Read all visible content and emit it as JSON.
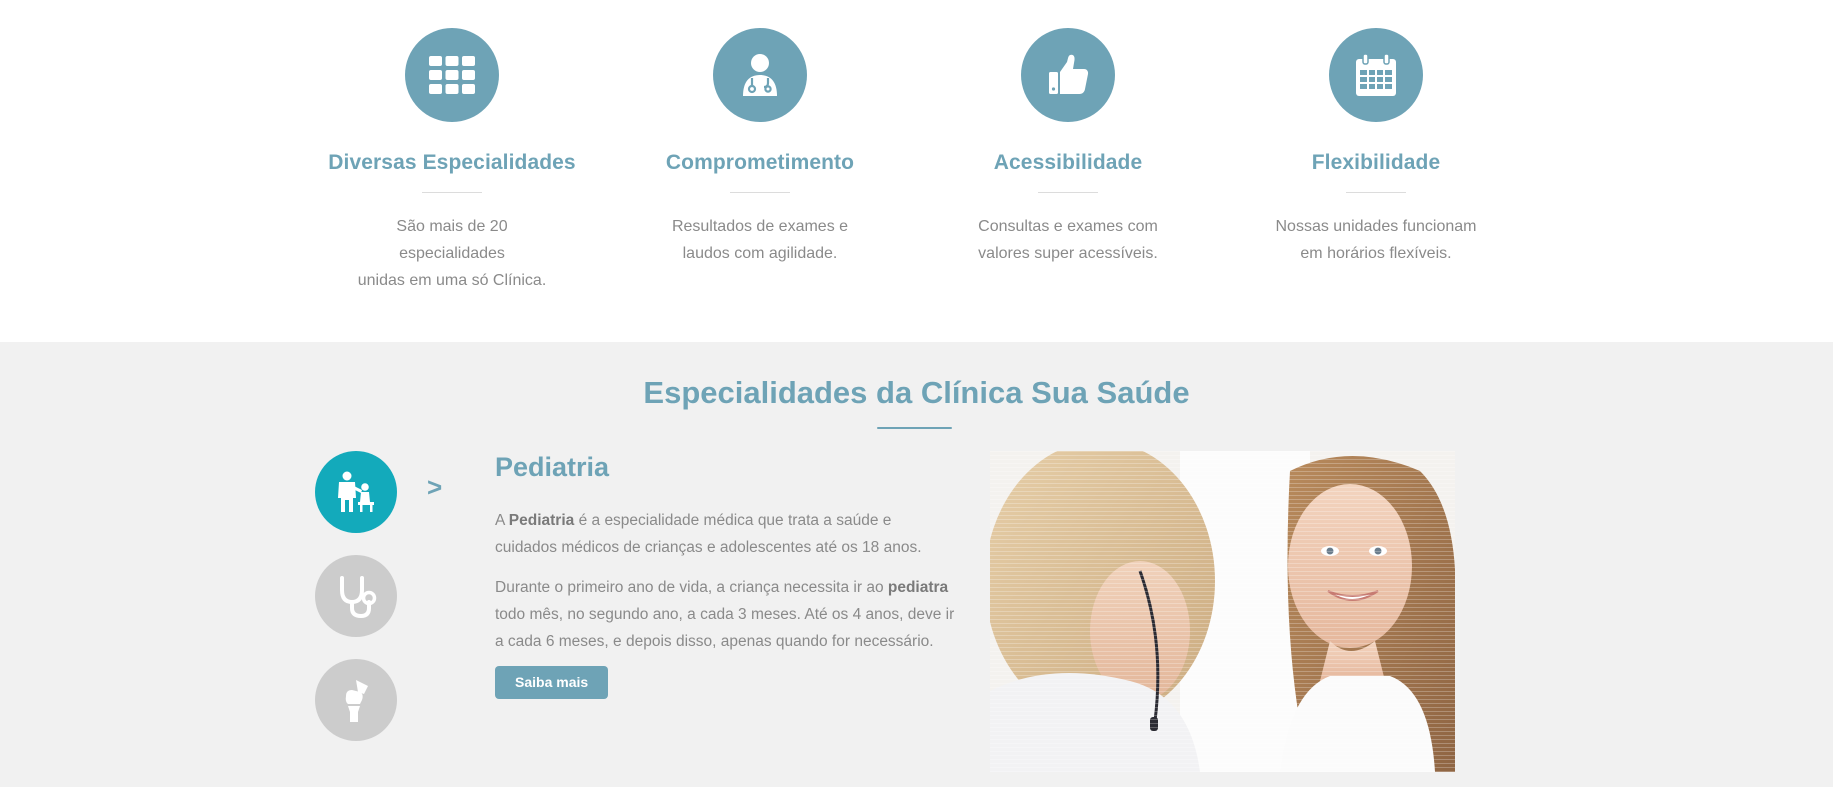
{
  "features": [
    {
      "icon": "grid-icon",
      "title": "Diversas Especialidades",
      "text_line1": "São mais de 20 especialidades",
      "text_line2": "unidas em uma só Clínica."
    },
    {
      "icon": "doctor-icon",
      "title": "Comprometimento",
      "text_line1": "Resultados de exames e",
      "text_line2": "laudos com agilidade."
    },
    {
      "icon": "thumbs-up-icon",
      "title": "Acessibilidade",
      "text_line1": "Consultas e exames com",
      "text_line2": "valores super acessíveis."
    },
    {
      "icon": "calendar-icon",
      "title": "Flexibilidade",
      "text_line1": "Nossas unidades funcionam",
      "text_line2": "em horários flexíveis."
    }
  ],
  "specialties": {
    "section_title": "Especialidades da Clínica Sua Saúde",
    "tabs": [
      {
        "icon": "pediatrics-icon",
        "active": true
      },
      {
        "icon": "stethoscope-icon",
        "active": false
      },
      {
        "icon": "orthopedics-knee-icon",
        "active": false
      }
    ],
    "arrow": ">",
    "active": {
      "title": "Pediatria",
      "p1_pre": "A ",
      "p1_bold": "Pediatria",
      "p1_post": " é a especialidade médica que trata a saúde e cuidados médicos de crianças e adolescentes até os 18 anos.",
      "p2_pre": "Durante o primeiro ano de vida, a criança necessita ir ao ",
      "p2_bold": "pediatra",
      "p2_post": " todo mês, no segundo ano, a cada 3 meses. Até os 4 anos, deve ir a cada 6 meses, e depois disso, apenas quando for necessário.",
      "button_label": "Saiba mais"
    },
    "photo": "doctor-with-smiling-girl-photo"
  },
  "colors": {
    "accent": "#6ea3b6",
    "active_tab": "#13aabb",
    "inactive_tab": "#cccccc",
    "section_bg": "#f1f1f1",
    "body_text": "#8a8a8a"
  }
}
